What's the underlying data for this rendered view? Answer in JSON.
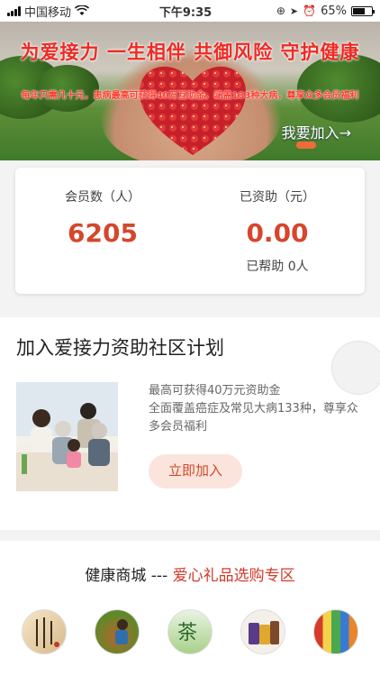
{
  "status_bar": {
    "carrier": "中国移动",
    "time": "下午9:35",
    "battery": "65%",
    "battery_level": 0.65
  },
  "banner": {
    "headline": "为爱接力 一生相伴 共御风险 守护健康",
    "subline": "每年只需几十元，患病最高可获得40万互助金，涵盖133种大病，尊享众多会员福利",
    "join_link": "我要加入→"
  },
  "stats": {
    "members_label": "会员数（人）",
    "members_value": "6205",
    "funded_label": "已资助（元）",
    "funded_value": "0.00",
    "helped_text": "已帮助 0人"
  },
  "plan": {
    "title": "加入爱接力资助社区计划",
    "line1": "最高可获得40万元资助金",
    "line2": "全面覆盖癌症及常见大病133种，尊享众多会员福利",
    "button": "立即加入"
  },
  "shop": {
    "title_prefix": "健康商城 --- ",
    "title_accent": "爱心礼品选购专区",
    "items": [
      "calligraphy-item",
      "tea-harvest-item",
      "tea-cup-item",
      "health-product-item",
      "supermarket-item"
    ]
  },
  "colors": {
    "accent_red": "#d6462c",
    "button_bg": "#fbe4dc"
  }
}
